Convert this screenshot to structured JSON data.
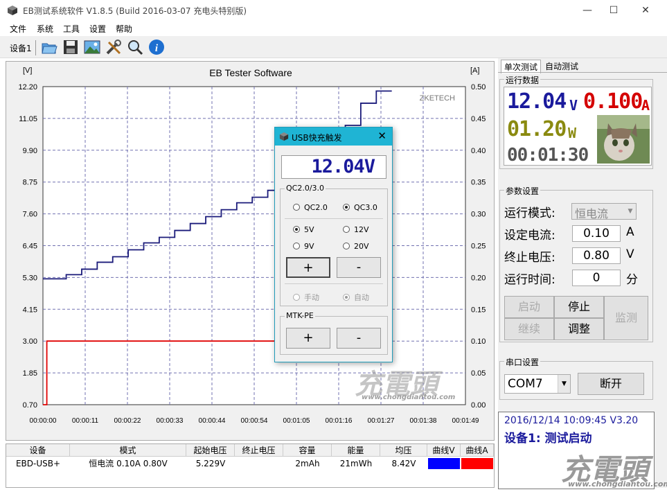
{
  "window": {
    "title": "EB测试系统软件 V1.8.5 (Build 2016-03-07 充电头特别版)",
    "icon": "cube-icon",
    "controls": [
      "minimize-icon",
      "maximize-icon",
      "close-icon"
    ]
  },
  "menu": [
    "文件",
    "系统",
    "工具",
    "设置",
    "帮助"
  ],
  "toolbar": {
    "device_tab": "设备1",
    "icons": [
      "open-folder-icon",
      "save-icon",
      "picture-icon",
      "tools-icon",
      "search-icon",
      "info-icon"
    ]
  },
  "chart": {
    "title": "EB Tester Software",
    "y_left_unit": "[V]",
    "y_right_unit": "[A]",
    "brand": "ZKETECH",
    "left_ticks": [
      "12.20",
      "11.05",
      "9.90",
      "8.75",
      "7.60",
      "6.45",
      "5.30",
      "4.15",
      "3.00",
      "1.85",
      "0.70"
    ],
    "right_ticks": [
      "0.50",
      "0.45",
      "0.40",
      "0.35",
      "0.30",
      "0.25",
      "0.20",
      "0.15",
      "0.10",
      "0.05",
      "0.00"
    ],
    "x_ticks": [
      "00:00:00",
      "00:00:11",
      "00:00:22",
      "00:00:33",
      "00:00:44",
      "00:00:54",
      "00:01:05",
      "00:01:16",
      "00:01:27",
      "00:01:38",
      "00:01:49"
    ],
    "voltage_color": "#1a1a7a",
    "current_color": "#e00000",
    "grid_color": "#7070b0"
  },
  "chart_data": {
    "type": "line",
    "title": "EB Tester Software",
    "xlabel": "",
    "ylabel": "[V]",
    "y2label": "[A]",
    "xlim": [
      "00:00:00",
      "00:01:49"
    ],
    "ylim": [
      0.7,
      12.2
    ],
    "y2lim": [
      0.0,
      0.5
    ],
    "grid": true,
    "series": [
      {
        "name": "曲线V",
        "axis": "left",
        "x_seconds": [
          0,
          6,
          10,
          14,
          18,
          22,
          26,
          30,
          34,
          38,
          42,
          46,
          50,
          54,
          58,
          62,
          66,
          70,
          74,
          78,
          82,
          86
        ],
        "values": [
          5.25,
          5.4,
          5.6,
          5.85,
          6.05,
          6.3,
          6.55,
          6.75,
          7.0,
          7.25,
          7.5,
          7.75,
          8.0,
          8.2,
          8.45,
          8.7,
          8.95,
          9.2,
          10.0,
          10.8,
          11.6,
          12.04
        ]
      },
      {
        "name": "曲线A",
        "axis": "right",
        "x_seconds": [
          0,
          1,
          60
        ],
        "values": [
          0.0,
          0.1,
          0.1
        ]
      }
    ]
  },
  "dialog": {
    "title": "USB快充触发",
    "display": "12.04V",
    "qc_group": "QC2.0/3.0",
    "qc_options": [
      {
        "label": "QC2.0",
        "selected": false
      },
      {
        "label": "QC3.0",
        "selected": true
      }
    ],
    "voltage_options": [
      {
        "label": "5V",
        "selected": true
      },
      {
        "label": "12V",
        "selected": false
      },
      {
        "label": "9V",
        "selected": false
      },
      {
        "label": "20V",
        "selected": false
      }
    ],
    "plus": "+",
    "minus": "-",
    "mode_options": [
      {
        "label": "手动",
        "selected": false
      },
      {
        "label": "自动",
        "selected": true
      }
    ],
    "mtk_group": "MTK-PE"
  },
  "right": {
    "tabs": [
      "单次测试",
      "自动测试"
    ],
    "run_data_label": "运行数据",
    "voltage": "12.04",
    "voltage_unit": "V",
    "current": "0.100",
    "current_unit": "A",
    "power": "01.20",
    "power_unit": "W",
    "time": "00:01:30",
    "params_label": "参数设置",
    "mode_label": "运行模式:",
    "mode_value": "恒电流",
    "set_current_label": "设定电流:",
    "set_current_value": "0.10",
    "set_current_unit": "A",
    "stop_voltage_label": "终止电压:",
    "stop_voltage_value": "0.80",
    "stop_voltage_unit": "V",
    "run_time_label": "运行时间:",
    "run_time_value": "0",
    "run_time_unit": "分",
    "buttons": {
      "start": "启动",
      "stop": "停止",
      "continue": "继续",
      "adjust": "调整",
      "monitor": "监测"
    },
    "serial_label": "串口设置",
    "com_port": "COM7",
    "disconnect": "断开",
    "log_line1": "2016/12/14 10:09:45  V3.20",
    "log_line2": "设备1: 测试启动"
  },
  "table": {
    "headers": [
      "设备",
      "模式",
      "起始电压",
      "终止电压",
      "容量",
      "能量",
      "均压",
      "曲线V",
      "曲线A"
    ],
    "row": [
      "EBD-USB+",
      "恒电流  0.10A  0.80V",
      "5.229V",
      "",
      "2mAh",
      "21mWh",
      "8.42V",
      "",
      ""
    ],
    "curve_v_color": "#0000ff",
    "curve_a_color": "#ff0000"
  },
  "watermark": {
    "logo": "充電頭",
    "url": "www.chongdiantou.com"
  }
}
